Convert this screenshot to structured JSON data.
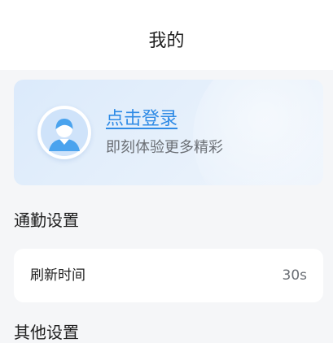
{
  "header": {
    "title": "我的"
  },
  "login_card": {
    "link_label": "点击登录",
    "subtitle": "即刻体验更多精彩",
    "avatar_icon": "user-avatar-icon"
  },
  "sections": {
    "commute": {
      "title": "通勤设置",
      "refresh_row": {
        "label": "刷新时间",
        "value": "30s"
      }
    },
    "other": {
      "title": "其他设置"
    }
  },
  "colors": {
    "accent": "#2f8be6",
    "card_background": "#e6f0fb",
    "page_background": "#f5f6f8"
  }
}
